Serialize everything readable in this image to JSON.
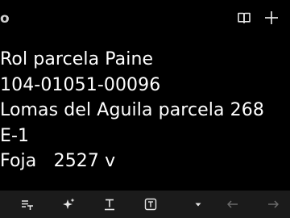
{
  "header": {
    "left_glyph": "o",
    "icons": [
      "reader-mode-icon",
      "add-icon"
    ]
  },
  "note": {
    "lines": [
      "Rol parcela Paine",
      "104-01051-00096",
      "Lomas del Aguila parcela 268",
      "E-1",
      "Foja   2527 v"
    ]
  },
  "toolbar": {
    "icons": [
      "text-size-icon",
      "ai-sparkle-icon",
      "text-style-icon",
      "text-box-icon",
      "dropdown-arrow-icon",
      "undo-icon",
      "redo-icon"
    ]
  },
  "colors": {
    "background": "#000000",
    "text": "#ffffff",
    "toolbar": "#1b1b1b",
    "icon": "#e6e6e6",
    "icon_disabled": "#6a6a6a"
  }
}
